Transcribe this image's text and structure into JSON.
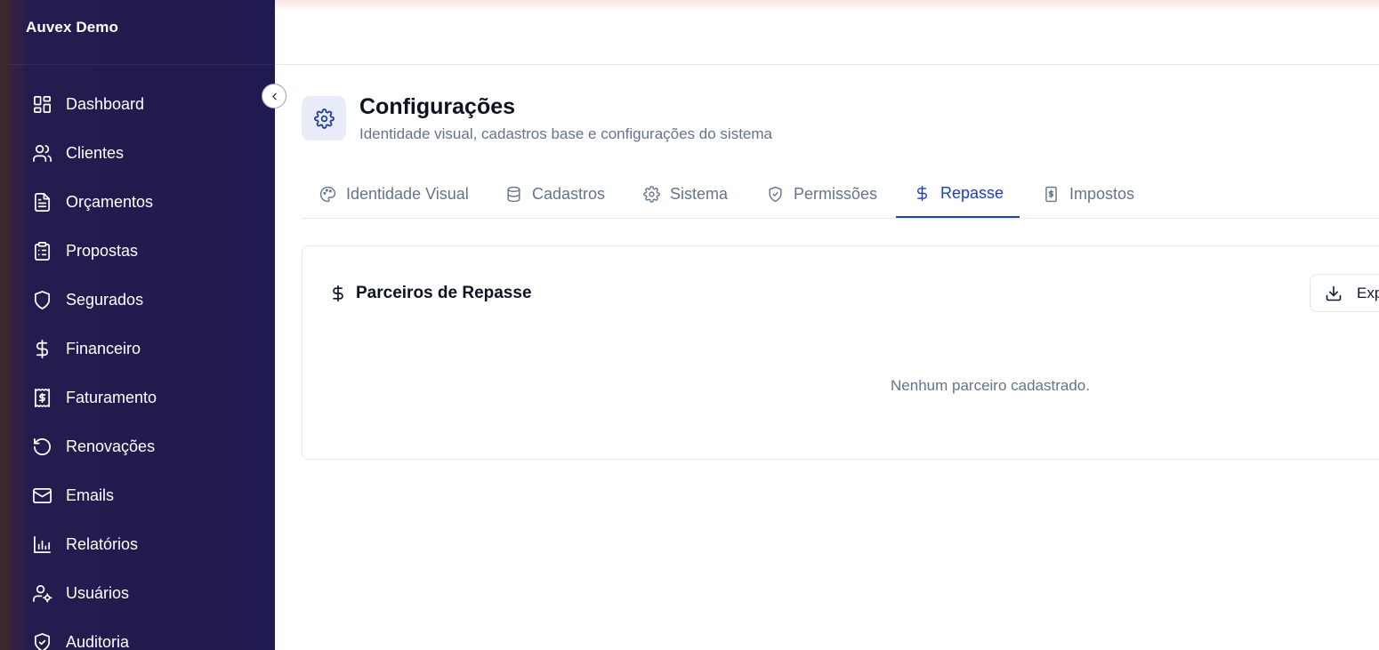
{
  "app": {
    "brand": "Auvex Demo"
  },
  "sidebar": {
    "items": [
      {
        "label": "Dashboard",
        "icon": "dashboard-icon"
      },
      {
        "label": "Clientes",
        "icon": "users-icon"
      },
      {
        "label": "Orçamentos",
        "icon": "document-icon"
      },
      {
        "label": "Propostas",
        "icon": "clipboard-list-icon"
      },
      {
        "label": "Segurados",
        "icon": "shield-icon"
      },
      {
        "label": "Financeiro",
        "icon": "dollar-icon"
      },
      {
        "label": "Faturamento",
        "icon": "receipt-icon"
      },
      {
        "label": "Renovações",
        "icon": "rotate-icon"
      },
      {
        "label": "Emails",
        "icon": "mail-icon"
      },
      {
        "label": "Relatórios",
        "icon": "bar-chart-icon"
      },
      {
        "label": "Usuários",
        "icon": "user-cog-icon"
      },
      {
        "label": "Auditoria",
        "icon": "shield-check-icon"
      }
    ]
  },
  "header": {
    "title": "Configurações",
    "subtitle": "Identidade visual, cadastros base e configurações do sistema",
    "icon": "gear-icon"
  },
  "tabs": [
    {
      "label": "Identidade Visual",
      "icon": "palette-icon",
      "active": false
    },
    {
      "label": "Cadastros",
      "icon": "database-icon",
      "active": false
    },
    {
      "label": "Sistema",
      "icon": "gear-icon",
      "active": false
    },
    {
      "label": "Permissões",
      "icon": "shield-check-icon",
      "active": false
    },
    {
      "label": "Repasse",
      "icon": "dollar-icon",
      "active": true
    },
    {
      "label": "Impostos",
      "icon": "receipt-icon",
      "active": false
    }
  ],
  "card": {
    "title": "Parceiros de Repasse",
    "title_icon": "dollar-icon",
    "export_label": "Exp",
    "export_icon": "download-icon",
    "empty_message": "Nenhum parceiro cadastrado."
  },
  "colors": {
    "sidebar_bg": "#1f1a4f",
    "accent": "#1e40af",
    "muted_text": "#64748b"
  }
}
